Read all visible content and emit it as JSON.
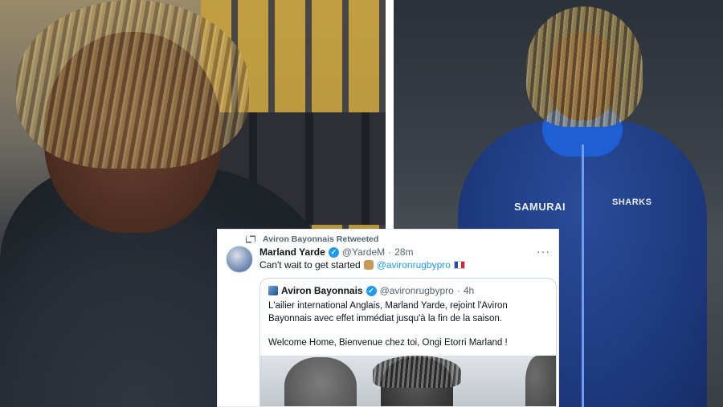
{
  "left_photo": {
    "description": "portrait"
  },
  "right_photo": {
    "brand_left": "SAMURAI",
    "brand_right": "SHARKS"
  },
  "tweet": {
    "retweet_label": "Aviron Bayonnais Retweeted",
    "author_name": "Marland Yarde",
    "author_handle": "@YardeM",
    "time": "28m",
    "more": "···",
    "text_before": "Can't wait to get started",
    "mention": "@avironrugbypro",
    "quote": {
      "author_name": "Aviron Bayonnais",
      "author_handle": "@avironrugbypro",
      "time": "4h",
      "paragraph_1": "L'ailier international Anglais, Marland Yarde, rejoint l'Aviron Bayonnais avec effet immédiat jusqu'à la fin de la saison.",
      "paragraph_2": "Welcome Home, Bienvenue chez toi, Ongi Etorri Marland !"
    }
  },
  "colors": {
    "link": "#1d9bf0",
    "muted": "#536471",
    "verified": "#1d9bf0"
  }
}
